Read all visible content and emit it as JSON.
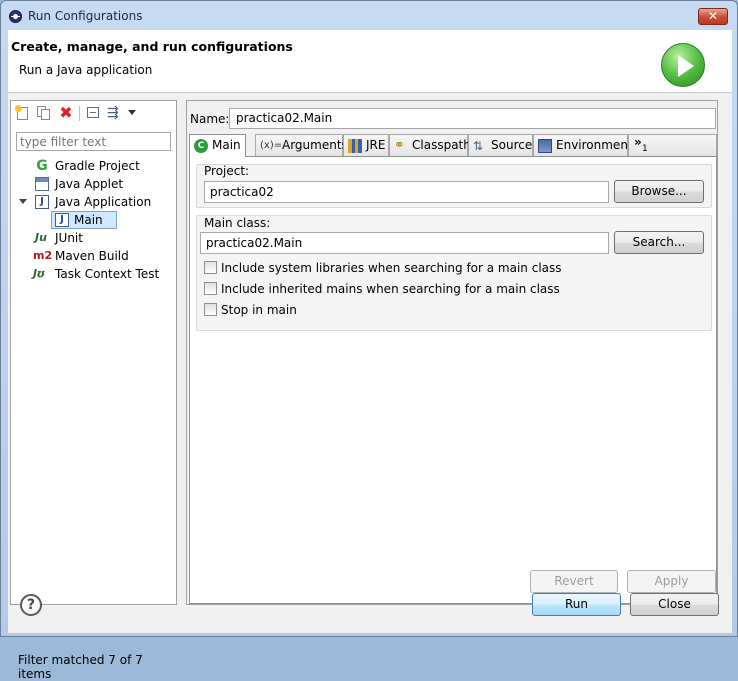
{
  "window": {
    "title": "Run Configurations",
    "close_glyph": "✕"
  },
  "header": {
    "title": "Create, manage, and run configurations",
    "subtitle": "Run a Java application",
    "icon": "run-icon"
  },
  "left": {
    "toolbar": {
      "delete_glyph": "✖",
      "filter_glyph": "⇶"
    },
    "filter_placeholder": "type filter text",
    "tree": [
      {
        "label": "Gradle Project",
        "icon": "gradle-icon",
        "glyph": "G"
      },
      {
        "label": "Java Applet",
        "icon": "java-applet-icon"
      },
      {
        "label": "Java Application",
        "icon": "java-application-icon",
        "glyph": "J",
        "expanded": true
      },
      {
        "label": "Main",
        "icon": "java-application-icon",
        "glyph": "J",
        "selected": true
      },
      {
        "label": "JUnit",
        "icon": "junit-icon",
        "glyph": "Ju"
      },
      {
        "label": "Maven Build",
        "icon": "maven-icon",
        "glyph": "m2"
      },
      {
        "label": "Task Context Test",
        "icon": "task-context-icon",
        "glyph": "Jʊ"
      }
    ],
    "footer": "Filter matched 7 of 7 items"
  },
  "right": {
    "name_label": "Name:",
    "name_value": "practica02.Main",
    "tabs": [
      {
        "label": "Main",
        "icon": "main-class-icon",
        "glyph": "C",
        "active": true
      },
      {
        "label": "Arguments",
        "icon": "arguments-icon",
        "glyph": "(x)="
      },
      {
        "label": "JRE",
        "icon": "jre-icon"
      },
      {
        "label": "Classpath",
        "icon": "classpath-icon",
        "glyph": "⚭"
      },
      {
        "label": "Source",
        "icon": "source-icon",
        "glyph": "⇅"
      },
      {
        "label": "Environment",
        "icon": "environment-icon"
      }
    ],
    "overflow": {
      "glyph": "»",
      "count": "1"
    },
    "project": {
      "label": "Project:",
      "value": "practica02",
      "browse": "Browse..."
    },
    "main_class": {
      "label": "Main class:",
      "value": "practica02.Main",
      "search": "Search..."
    },
    "options": [
      {
        "label": "Include system libraries when searching for a main class",
        "checked": false
      },
      {
        "label": "Include inherited mains when searching for a main class",
        "checked": false
      },
      {
        "label": "Stop in main",
        "checked": false
      }
    ],
    "revert": "Revert",
    "apply": "Apply"
  },
  "footer": {
    "help_glyph": "?",
    "run": "Run",
    "close": "Close"
  }
}
